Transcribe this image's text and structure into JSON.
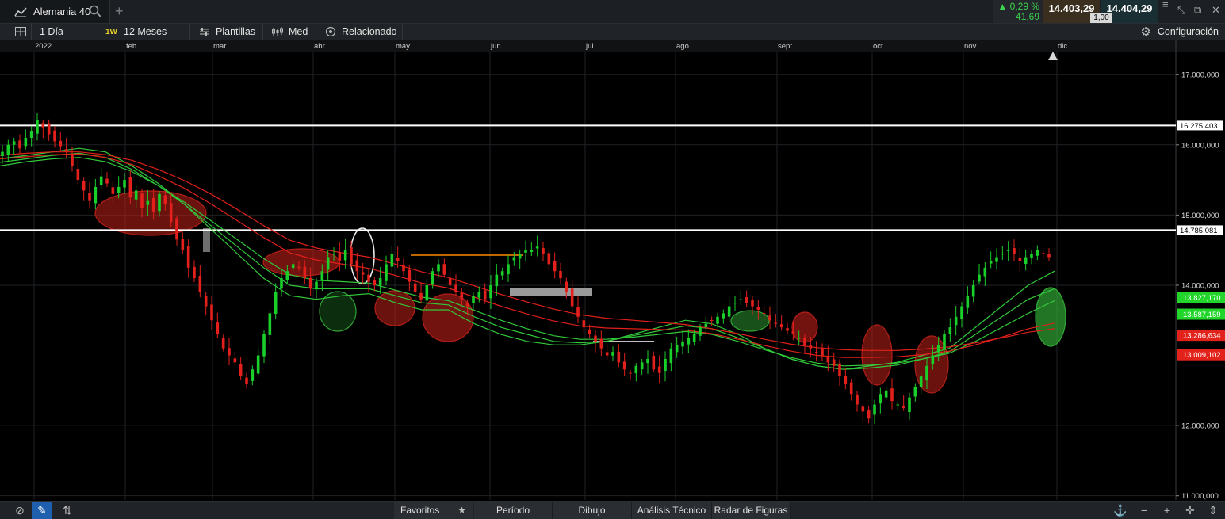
{
  "instrument": {
    "name": "Alemania 40"
  },
  "quote": {
    "change_pct": "0,29 %",
    "change_pts": "41,69",
    "sell": "14.403,29",
    "buy": "14.404,29",
    "spread": "1,00"
  },
  "toolbar": {
    "interval": "1 Día",
    "range_badge": "1W",
    "range": "12 Meses",
    "templates": "Plantillas",
    "indicators": "Med",
    "related": "Relacionado",
    "settings": "Configuración"
  },
  "bottombar": {
    "favorites": "Favoritos",
    "period": "Período",
    "drawing": "Dibujo",
    "technical": "Análisis Técnico",
    "patterns": "Radar de Figuras"
  },
  "colors": {
    "bg": "#000000",
    "up": "#19d02a",
    "down": "#e3201c",
    "ma_green": "#31c83a",
    "ma_red": "#e1201a",
    "level_line": "#ffffff"
  },
  "chart_data": {
    "type": "candlestick",
    "x_tick_labels": [
      "2022",
      "feb.",
      "mar.",
      "abr.",
      "may.",
      "jun.",
      "jul.",
      "ago.",
      "sept.",
      "oct.",
      "nov.",
      "dic."
    ],
    "y_tick_labels": [
      "17.000,000",
      "16.000,000",
      "15.000,000",
      "14.000,000",
      "12.000,000",
      "11.000,000"
    ],
    "ylim": [
      10940,
      17330
    ],
    "horizontal_levels": [
      16275.403,
      14785.081
    ],
    "level_labels": [
      "16.275,403",
      "14.785,081"
    ],
    "price_tags": [
      {
        "label": "13.827,170",
        "value": 13827.17,
        "color": "#22d52a"
      },
      {
        "label": "13.587,159",
        "value": 13587.159,
        "color": "#22d52a"
      },
      {
        "label": "13.286,634",
        "value": 13286.634,
        "color": "#e2231c"
      },
      {
        "label": "13.009,102",
        "value": 13009.102,
        "color": "#e2231c"
      }
    ],
    "series": [
      {
        "name": "",
        "closes": [
          15900,
          16000,
          16050,
          15950,
          16100,
          16200,
          16350,
          16250,
          16150,
          16050,
          15980,
          15900,
          15700,
          15500,
          15350,
          15200,
          15400,
          15550,
          15450,
          15300,
          15400,
          15500,
          15250,
          15350,
          15100,
          15200,
          15050,
          15300,
          15150,
          14900,
          14650,
          14500,
          14250,
          14100,
          13900,
          13700,
          13500,
          13300,
          13100,
          13000,
          12900,
          12700,
          12600,
          12800,
          13000,
          13300,
          13600,
          13900,
          14100,
          14200,
          14300,
          14250,
          14100,
          13950,
          14050,
          14200,
          14400,
          14450,
          14350,
          14500,
          14300,
          14200,
          14150,
          14050,
          14000,
          14100,
          14300,
          14450,
          14350,
          14200,
          14050,
          13900,
          13800,
          14000,
          14200,
          14300,
          14150,
          14000,
          13900,
          13800,
          13700,
          13850,
          13900,
          13800,
          14000,
          14150,
          14200,
          14300,
          14400,
          14450,
          14500,
          14500,
          14550,
          14450,
          14300,
          14200,
          14100,
          13900,
          13700,
          13550,
          13400,
          13300,
          13200,
          13100,
          13000,
          13050,
          12900,
          12800,
          12750,
          12850,
          12900,
          12950,
          12800,
          12750,
          12950,
          13100,
          13150,
          13200,
          13250,
          13300,
          13400,
          13450,
          13500,
          13550,
          13600,
          13700,
          13750,
          13800,
          13750,
          13700,
          13650,
          13600,
          13500,
          13450,
          13400,
          13350,
          13300,
          13250,
          13150,
          13100,
          13050,
          13000,
          12900,
          12850,
          12700,
          12600,
          12450,
          12300,
          12200,
          12100,
          12300,
          12450,
          12500,
          12350,
          12300,
          12250,
          12400,
          12550,
          12700,
          12850,
          13000,
          13150,
          13300,
          13400,
          13550,
          13700,
          13850,
          14000,
          14150,
          14250,
          14350,
          14400,
          14450,
          14500,
          14450,
          14350,
          14400,
          14450,
          14500,
          14450,
          14400
        ]
      }
    ],
    "moving_averages": {
      "green": [
        [
          15800,
          15850,
          15900,
          15950,
          15900,
          15700,
          15450,
          15150,
          14800,
          14450,
          14100,
          13850,
          13800,
          13850,
          13880,
          13750,
          13650,
          13650,
          13450,
          13300,
          13200,
          13150,
          13150,
          13200,
          13300,
          13400,
          13500,
          13450,
          13300,
          13100,
          12950,
          12850,
          12800,
          12850,
          12900,
          13000,
          13100,
          13400,
          13700,
          14000,
          14200
        ],
        [
          15750,
          15800,
          15850,
          15880,
          15820,
          15650,
          15420,
          15150,
          14850,
          14550,
          14250,
          14000,
          13950,
          13950,
          13950,
          13850,
          13750,
          13720,
          13550,
          13400,
          13300,
          13200,
          13180,
          13200,
          13280,
          13350,
          13420,
          13380,
          13250,
          13100,
          12950,
          12850,
          12800,
          12820,
          12860,
          12950,
          13050,
          13300,
          13550,
          13800,
          13950
        ],
        [
          15700,
          15760,
          15800,
          15820,
          15760,
          15620,
          15420,
          15180,
          14920,
          14650,
          14380,
          14150,
          14070,
          14050,
          14030,
          13930,
          13830,
          13780,
          13640,
          13500,
          13380,
          13280,
          13230,
          13230,
          13260,
          13300,
          13340,
          13300,
          13200,
          13080,
          12970,
          12890,
          12850,
          12860,
          12890,
          12950,
          13030,
          13200,
          13400,
          13600,
          13780
        ]
      ],
      "red": [
        [
          15800,
          15830,
          15860,
          15870,
          15820,
          15720,
          15560,
          15380,
          15160,
          14920,
          14680,
          14460,
          14360,
          14300,
          14240,
          14140,
          14030,
          13960,
          13830,
          13700,
          13590,
          13490,
          13420,
          13390,
          13380,
          13370,
          13360,
          13310,
          13230,
          13140,
          13060,
          13000,
          12970,
          12970,
          12980,
          13010,
          13060,
          13150,
          13260,
          13380,
          13460
        ],
        [
          15850,
          15880,
          15900,
          15900,
          15860,
          15780,
          15650,
          15490,
          15300,
          15080,
          14850,
          14640,
          14530,
          14460,
          14400,
          14300,
          14190,
          14110,
          13990,
          13870,
          13760,
          13660,
          13580,
          13530,
          13500,
          13470,
          13440,
          13380,
          13310,
          13230,
          13160,
          13110,
          13080,
          13070,
          13070,
          13090,
          13120,
          13180,
          13250,
          13330,
          13380
        ]
      ]
    },
    "drawn_shapes": [
      "red ellipses marking resistance clusters",
      "green ellipses marking support clusters",
      "white ellipse",
      "orange and white short horizontal lines",
      "grey rectangle zone"
    ]
  }
}
